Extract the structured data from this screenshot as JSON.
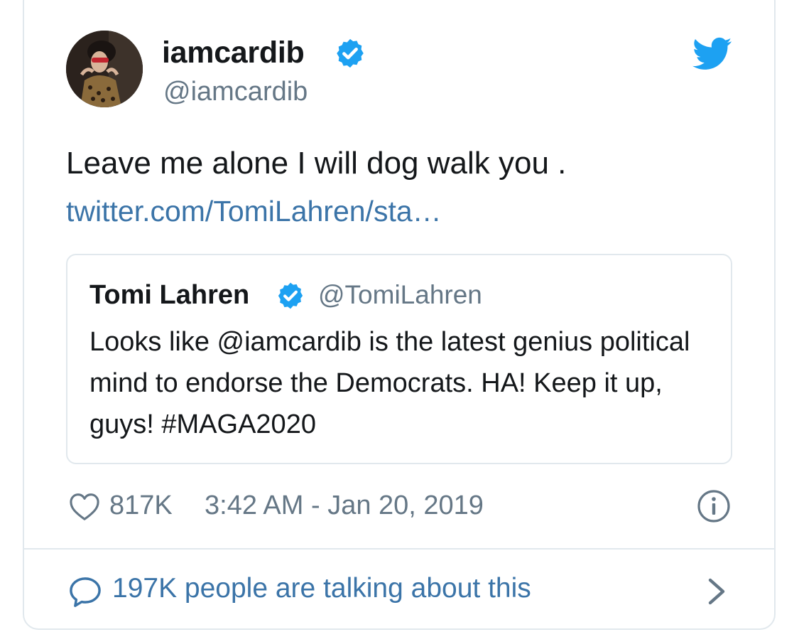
{
  "tweet": {
    "display_name": "iamcardib",
    "handle": "@iamcardib",
    "text": "Leave me alone I will dog walk you .",
    "link": "twitter.com/TomiLahren/sta…",
    "likes": "817K",
    "timestamp": "3:42 AM - Jan 20, 2019"
  },
  "quoted": {
    "display_name": "Tomi Lahren",
    "handle": "@TomiLahren",
    "text": "Looks like @iamcardib is the latest genius political mind to endorse the Democrats. HA! Keep it up, guys! #MAGA2020"
  },
  "footer": {
    "talking_text": "197K people are talking about this"
  },
  "icons": {
    "verified": "verified-badge-icon",
    "brand": "twitter-bird-icon",
    "like": "heart-icon",
    "info": "info-icon",
    "reply": "reply-bubble-icon",
    "chevron": "chevron-right-icon"
  },
  "colors": {
    "verified_blue": "#1da1f2",
    "link_blue": "#3b74a8",
    "muted_gray": "#657786",
    "text_dark": "#14171a",
    "border": "#e1e8ed"
  }
}
